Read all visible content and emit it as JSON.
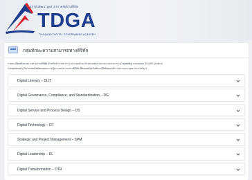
{
  "header": {
    "tagline": "สถาบันพัฒนาบุคลากรภาครัฐด้านดิจิทัล",
    "logo_text": "TDGA",
    "logo_subtitle": "THAILAND DIGITAL GOVERNMENT ACADEMY",
    "colors": {
      "navy": "#1e3d8f",
      "red": "#d8262c"
    }
  },
  "panel": {
    "title": "กลุ่มทักษะความสามารถทางดิจิทัล",
    "description": [
      "รายละเอียดทักษะความสามารถดิจิทัล สำหรับข้าราชการฯ (ประกอบด้วย 39 หน่วยสมรรถนะความสามารถ (Capability) ครอบคลุม 39 UOC (Unit of",
      "Competence)) รับรองผลลัพธ์ทดสอบความรู้ความสามารถทางดิจิทัล ที่สอดคล้องกับทักษะดิจิทัลของข้าราชการและบุคลากรภาครัฐ 4"
    ],
    "items": [
      {
        "label": "Digital Literacy – DLIT"
      },
      {
        "label": "Digital Governance, Compliance, and Standardization – DG"
      },
      {
        "label": "Digital Service and Process Design – DS"
      },
      {
        "label": "Digital Technology – DT"
      },
      {
        "label": "Strategic and Project Management – SPM"
      },
      {
        "label": "Digital Leadership – DL"
      },
      {
        "label": "Digital Transformation – DTR"
      }
    ]
  }
}
